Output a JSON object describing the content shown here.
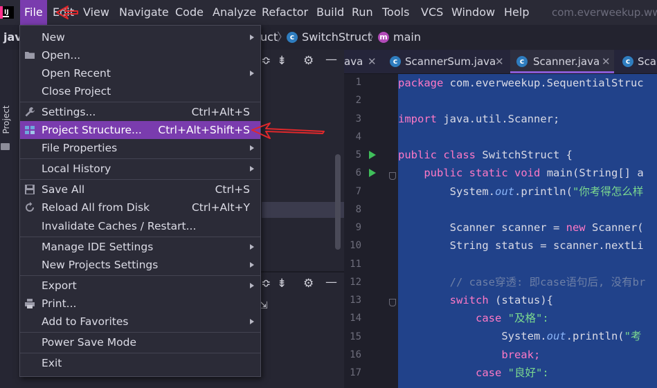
{
  "menubar": {
    "items": [
      "File",
      "Edit",
      "View",
      "Navigate",
      "Code",
      "Analyze",
      "Refactor",
      "Build",
      "Run",
      "Tools",
      "VCS",
      "Window",
      "Help"
    ],
    "window_title": "com.everweekup.ww"
  },
  "navbar": {
    "left_text": "jav",
    "mid_text": "uct",
    "class_name": "SwitchStruct",
    "method_name": "main"
  },
  "sidebar": {
    "label": "Project"
  },
  "file_menu": {
    "items": [
      {
        "label": "New",
        "shortcut": "",
        "submenu": true,
        "icon": ""
      },
      {
        "label": "Open...",
        "shortcut": "",
        "submenu": false,
        "icon": "folder-icon"
      },
      {
        "label": "Open Recent",
        "shortcut": "",
        "submenu": true,
        "icon": ""
      },
      {
        "label": "Close Project",
        "shortcut": "",
        "submenu": false,
        "icon": ""
      },
      {
        "label": "Settings...",
        "shortcut": "Ctrl+Alt+S",
        "submenu": false,
        "icon": "wrench-icon"
      },
      {
        "label": "Project Structure...",
        "shortcut": "Ctrl+Alt+Shift+S",
        "submenu": false,
        "icon": "project-structure-icon"
      },
      {
        "label": "File Properties",
        "shortcut": "",
        "submenu": true,
        "icon": ""
      },
      {
        "label": "Local History",
        "shortcut": "",
        "submenu": true,
        "icon": ""
      },
      {
        "label": "Save All",
        "shortcut": "Ctrl+S",
        "submenu": false,
        "icon": "save-icon"
      },
      {
        "label": "Reload All from Disk",
        "shortcut": "Ctrl+Alt+Y",
        "submenu": false,
        "icon": "reload-icon"
      },
      {
        "label": "Invalidate Caches / Restart...",
        "shortcut": "",
        "submenu": false,
        "icon": ""
      },
      {
        "label": "Manage IDE Settings",
        "shortcut": "",
        "submenu": true,
        "icon": ""
      },
      {
        "label": "New Projects Settings",
        "shortcut": "",
        "submenu": true,
        "icon": ""
      },
      {
        "label": "Export",
        "shortcut": "",
        "submenu": true,
        "icon": ""
      },
      {
        "label": "Print...",
        "shortcut": "",
        "submenu": false,
        "icon": "print-icon"
      },
      {
        "label": "Add to Favorites",
        "shortcut": "",
        "submenu": true,
        "icon": ""
      },
      {
        "label": "Power Save Mode",
        "shortcut": "",
        "submenu": false,
        "icon": ""
      },
      {
        "label": "Exit",
        "shortcut": "",
        "submenu": false,
        "icon": ""
      }
    ],
    "highlighted": "Project Structure..."
  },
  "editor": {
    "tabs": [
      {
        "label": "ava",
        "active": false
      },
      {
        "label": "ScannerSum.java",
        "active": false
      },
      {
        "label": "Scanner.java",
        "active": true
      },
      {
        "label": "Sca",
        "active": false
      }
    ],
    "line_numbers": [
      "1",
      "2",
      "3",
      "4",
      "5",
      "6",
      "7",
      "8",
      "9",
      "10",
      "11",
      "12",
      "13",
      "14",
      "15",
      "16",
      "17"
    ],
    "code": {
      "l1": "com.everweekup.SequentialStruc",
      "l3": "java.util.Scanner;",
      "l5": "SwitchStruct {",
      "l6": "main(String[] a",
      "l7_a": "System.",
      "l7_b": "out",
      "l7_c": ".println(",
      "l7_d": "\"你考得怎么样",
      "l9_a": "Scanner scanner = ",
      "l9_b": "Scanner(",
      "l10": "String status = scanner.nextLi",
      "l12": "// case穿透: 即case语句后, 没有br",
      "l13": "(status){",
      "l14": "\"及格\":",
      "l15_a": "System.",
      "l15_b": "out",
      "l15_c": ".println(",
      "l15_d": "\"考",
      "l16": "break;",
      "l17": "\"良好\":"
    },
    "keywords": {
      "package": "package",
      "import": "import",
      "public": "public",
      "class": "class",
      "static": "static",
      "void": "void",
      "new": "new",
      "switch": "switch",
      "case": "case"
    }
  },
  "colors": {
    "accent": "#7a3cae",
    "annotation_arrow": "#e0282b",
    "editor_selection": "#21428a"
  }
}
